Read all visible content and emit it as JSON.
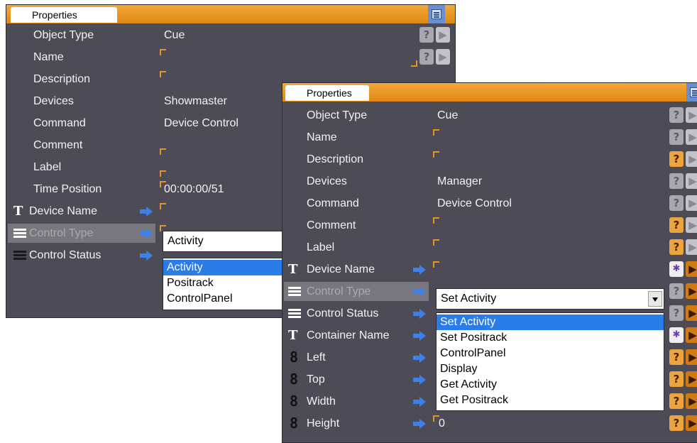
{
  "back_panel": {
    "tab_label": "Properties",
    "rows": [
      {
        "label": "Object Type",
        "value": "Cue"
      },
      {
        "label": "Name",
        "value": ""
      },
      {
        "label": "Description",
        "value": ""
      },
      {
        "label": "Devices",
        "value": "Showmaster"
      },
      {
        "label": "Command",
        "value": "Device Control"
      },
      {
        "label": "Comment",
        "value": ""
      },
      {
        "label": "Label",
        "value": ""
      },
      {
        "label": "Time Position",
        "value": "00:00:00/51"
      },
      {
        "label": "Device Name",
        "value": "",
        "icon": "text-icon"
      },
      {
        "label": "Control Type",
        "value": "Activity",
        "icon": "list-icon",
        "selected": true
      },
      {
        "label": "Control Status",
        "value": "",
        "icon": "list-icon"
      }
    ],
    "combo_value": "Activity",
    "dropdown_options": [
      "Activity",
      "Positrack",
      "ControlPanel"
    ],
    "highlighted_option": "Activity",
    "help_glyph": "?",
    "arrow_glyph": "▶"
  },
  "front_panel": {
    "tab_label": "Properties",
    "rows": [
      {
        "label": "Object Type",
        "value": "Cue"
      },
      {
        "label": "Name",
        "value": ""
      },
      {
        "label": "Description",
        "value": ""
      },
      {
        "label": "Devices",
        "value": "Manager"
      },
      {
        "label": "Command",
        "value": "Device Control"
      },
      {
        "label": "Comment",
        "value": ""
      },
      {
        "label": "Label",
        "value": ""
      },
      {
        "label": "Device Name",
        "value": "",
        "icon": "text-icon"
      },
      {
        "label": "Control Type",
        "value": "Set Activity",
        "icon": "list-icon",
        "selected": true
      },
      {
        "label": "Control Status",
        "value": "",
        "icon": "list-icon"
      },
      {
        "label": "Container Name",
        "value": "",
        "icon": "text-icon"
      },
      {
        "label": "Left",
        "value": "",
        "icon": "digit-icon"
      },
      {
        "label": "Top",
        "value": "",
        "icon": "digit-icon"
      },
      {
        "label": "Width",
        "value": "",
        "icon": "digit-icon"
      },
      {
        "label": "Height",
        "value": "0",
        "icon": "digit-icon"
      }
    ],
    "combo_value": "Set Activity",
    "dropdown_options": [
      "Set Activity",
      "Set Positrack",
      "ControlPanel",
      "Display",
      "Get Activity",
      "Get Positrack"
    ],
    "highlighted_option": "Set Activity",
    "help_glyph": "?",
    "arrow_glyph": "▶",
    "wand_glyph": "✱"
  },
  "colors": {
    "panel_bg": "#4d4c56",
    "title_orange": "#e8941e",
    "highlight_blue": "#2a7ce8",
    "link_arrow_blue": "#3e80e8"
  }
}
